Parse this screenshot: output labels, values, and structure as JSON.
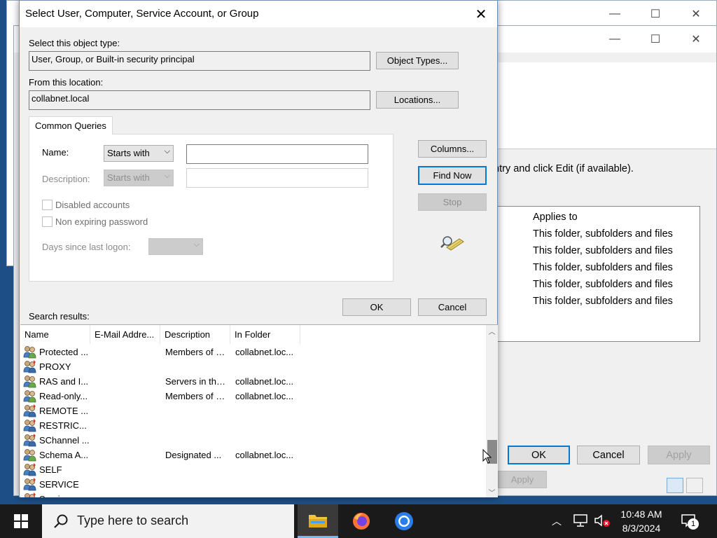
{
  "dialog": {
    "title": "Select User, Computer, Service Account, or Group",
    "object_type_label": "Select this object type:",
    "object_type_value": "User, Group, or Built-in security principal",
    "object_types_button": "Object Types...",
    "location_label": "From this location:",
    "location_value": "collabnet.local",
    "locations_button": "Locations...",
    "tab_label": "Common Queries",
    "name_label": "Name:",
    "name_filter": "Starts with",
    "name_value": "",
    "description_label": "Description:",
    "description_filter": "Starts with",
    "description_value": "",
    "disabled_accounts_label": "Disabled accounts",
    "non_expiring_label": "Non expiring password",
    "days_since_label": "Days since last logon:",
    "columns_button": "Columns...",
    "find_now_button": "Find Now",
    "stop_button": "Stop",
    "ok_button": "OK",
    "cancel_button": "Cancel",
    "search_results_label": "Search results:",
    "columns": [
      "Name",
      "E-Mail Addre...",
      "Description",
      "In Folder"
    ],
    "results": [
      {
        "icon": "group-icon",
        "name": "Protected ...",
        "email": "",
        "description": "Members of t...",
        "folder": "collabnet.loc..."
      },
      {
        "icon": "principal-icon",
        "name": "PROXY",
        "email": "",
        "description": "",
        "folder": ""
      },
      {
        "icon": "group-icon",
        "name": "RAS and I...",
        "email": "",
        "description": "Servers in thi...",
        "folder": "collabnet.loc..."
      },
      {
        "icon": "group-icon",
        "name": "Read-only...",
        "email": "",
        "description": "Members of t...",
        "folder": "collabnet.loc..."
      },
      {
        "icon": "principal-icon",
        "name": "REMOTE ...",
        "email": "",
        "description": "",
        "folder": ""
      },
      {
        "icon": "principal-icon",
        "name": "RESTRIC...",
        "email": "",
        "description": "",
        "folder": ""
      },
      {
        "icon": "principal-icon",
        "name": "SChannel ...",
        "email": "",
        "description": "",
        "folder": ""
      },
      {
        "icon": "group-icon",
        "name": "Schema A...",
        "email": "",
        "description": "Designated ...",
        "folder": "collabnet.loc..."
      },
      {
        "icon": "principal-icon",
        "name": "SELF",
        "email": "",
        "description": "",
        "folder": ""
      },
      {
        "icon": "principal-icon",
        "name": "SERVICE",
        "email": "",
        "description": "",
        "folder": ""
      },
      {
        "icon": "principal-icon",
        "name": "Service a...",
        "email": "",
        "description": "",
        "folder": ""
      }
    ]
  },
  "background_window": {
    "hint_text": "ntry and click Edit (if available).",
    "applies_to_header": "Applies to",
    "applies_to_rows": [
      "This folder, subfolders and files",
      "This folder, subfolders and files",
      "This folder, subfolders and files",
      "This folder, subfolders and files",
      "This folder, subfolders and files"
    ],
    "ok_button": "OK",
    "cancel_button": "Cancel",
    "apply_button": "Apply",
    "apply_button_behind": "Apply"
  },
  "taskbar": {
    "search_placeholder": "Type here to search",
    "time": "10:48 AM",
    "date": "8/3/2024",
    "notification_count": "1",
    "apps": [
      "file-explorer-icon",
      "firefox-icon",
      "chrome-icon"
    ]
  },
  "colors": {
    "accent": "#0078d7",
    "taskbar": "#1a1a1a",
    "dialog_bg": "#f0f0f0"
  }
}
